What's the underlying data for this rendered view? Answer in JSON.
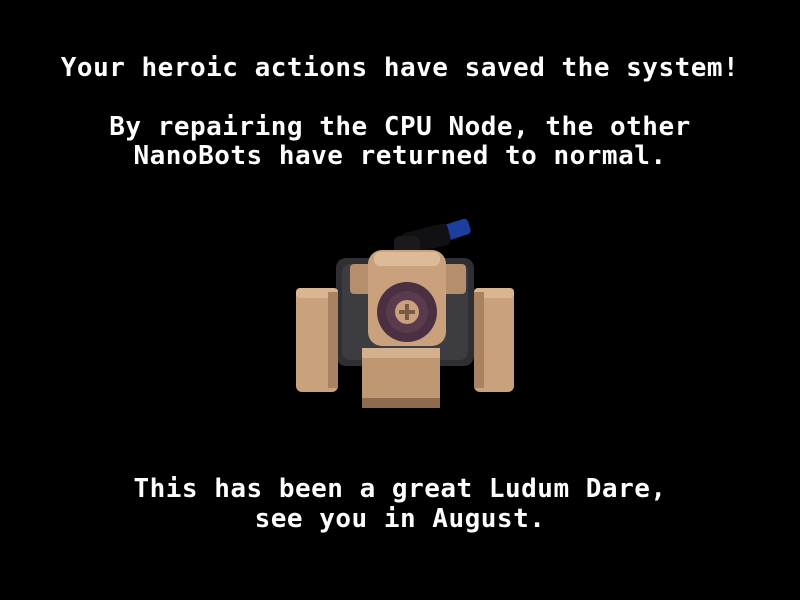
{
  "screen": {
    "headline": "Your heroic actions have saved the system!",
    "story_line_1": "By repairing the CPU Node, the other",
    "story_line_2": "NanoBots have returned to normal.",
    "closing_line_1": "This has been a great Ludum Dare,",
    "closing_line_2": "see you in August."
  },
  "robot": {
    "icon": "nanobot-robot-icon",
    "colors": {
      "tan": "#c9a27d",
      "tan_dark": "#8e6a4e",
      "dark_body": "#2f2f33",
      "purple": "#4a3040",
      "black": "#111114",
      "blue": "#1c3f9e"
    }
  },
  "colors": {
    "background": "#000000",
    "text": "#ffffff"
  }
}
